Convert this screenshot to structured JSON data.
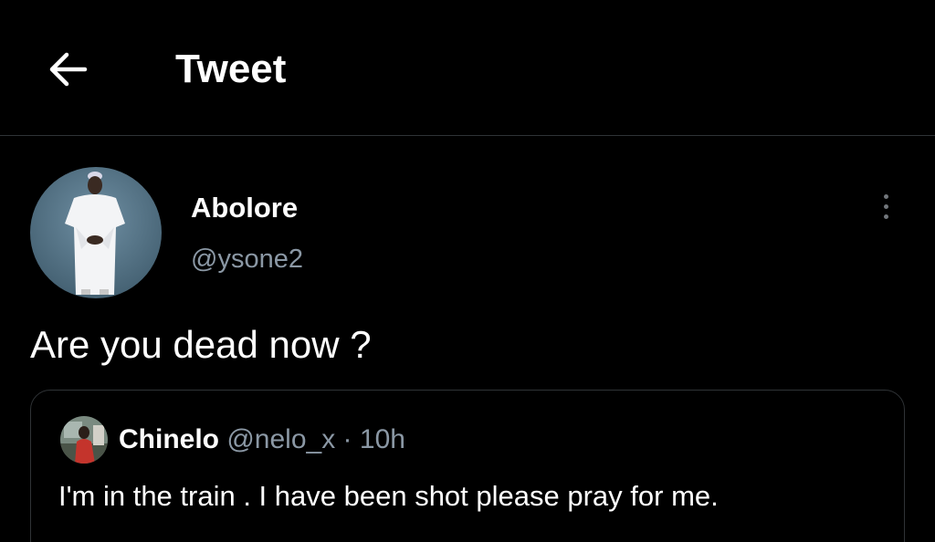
{
  "header": {
    "title": "Tweet",
    "back_icon": "arrow-left-icon"
  },
  "tweet": {
    "author": {
      "display_name": "Abolore",
      "handle": "@ysone2",
      "avatar_icon": "avatar-photo"
    },
    "more_icon": "more-vertical-icon",
    "text": "Are you dead now ?"
  },
  "quoted_tweet": {
    "author": {
      "display_name": "Chinelo",
      "handle": "@nelo_x",
      "separator": "·",
      "time": "10h"
    },
    "text": "I'm in the train .  I have been shot please pray for me."
  },
  "colors": {
    "background": "#000000",
    "text_primary": "#ffffff",
    "text_secondary": "#8b98a5",
    "border": "#2f3336"
  }
}
